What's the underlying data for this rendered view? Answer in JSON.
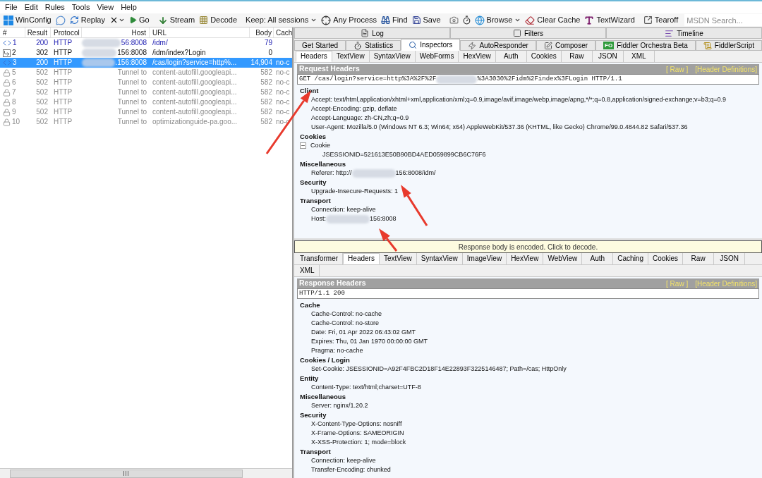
{
  "menu": [
    "File",
    "Edit",
    "Rules",
    "Tools",
    "View",
    "Help"
  ],
  "toolbar": [
    {
      "label": "WinConfig",
      "kind": "button"
    },
    {
      "label": "Replay",
      "kind": "button"
    },
    {
      "label": "Go",
      "kind": "button"
    },
    {
      "label": "Stream",
      "kind": "button"
    },
    {
      "label": "Decode",
      "kind": "button"
    },
    {
      "label": "Keep: All sessions",
      "kind": "dropdown"
    },
    {
      "label": "Any Process",
      "kind": "button"
    },
    {
      "label": "Find",
      "kind": "button"
    },
    {
      "label": "Save",
      "kind": "button"
    },
    {
      "label": "Browse",
      "kind": "dropdown"
    },
    {
      "label": "Clear Cache",
      "kind": "button"
    },
    {
      "label": "TextWizard",
      "kind": "button"
    },
    {
      "label": "Tearoff",
      "kind": "button"
    }
  ],
  "search": {
    "placeholder": "MSDN Search..."
  },
  "sessions": {
    "columns": [
      "#",
      "Result",
      "Protocol",
      "Host",
      "URL",
      "Body",
      "Cach"
    ],
    "rows": [
      {
        "num": "1",
        "result": "200",
        "protocol": "HTTP",
        "host": "56:8008",
        "host_redacted": true,
        "url": "/idm/",
        "body": "79",
        "kind": "html",
        "selected": false
      },
      {
        "num": "2",
        "result": "302",
        "protocol": "HTTP",
        "host": "156:8008",
        "host_redacted": true,
        "url": "/idm/index?Login",
        "body": "0",
        "kind": "redirect",
        "selected": false
      },
      {
        "num": "3",
        "result": "200",
        "protocol": "HTTP",
        "host": ".156:8008",
        "host_redacted": true,
        "url": "/cas/login?service=http%...",
        "body": "14,904",
        "caching": "no-c",
        "kind": "html",
        "selected": true
      },
      {
        "num": "5",
        "result": "502",
        "protocol": "HTTP",
        "host": "Tunnel to",
        "host_redacted": false,
        "url": "content-autofill.googleapi...",
        "body": "582",
        "caching": "no-c",
        "kind": "tunnel",
        "selected": false
      },
      {
        "num": "6",
        "result": "502",
        "protocol": "HTTP",
        "host": "Tunnel to",
        "host_redacted": false,
        "url": "content-autofill.googleapi...",
        "body": "582",
        "caching": "no-c",
        "kind": "tunnel",
        "selected": false
      },
      {
        "num": "7",
        "result": "502",
        "protocol": "HTTP",
        "host": "Tunnel to",
        "host_redacted": false,
        "url": "content-autofill.googleapi...",
        "body": "582",
        "caching": "no-c",
        "kind": "tunnel",
        "selected": false
      },
      {
        "num": "8",
        "result": "502",
        "protocol": "HTTP",
        "host": "Tunnel to",
        "host_redacted": false,
        "url": "content-autofill.googleapi...",
        "body": "582",
        "caching": "no-c",
        "kind": "tunnel",
        "selected": false
      },
      {
        "num": "9",
        "result": "502",
        "protocol": "HTTP",
        "host": "Tunnel to",
        "host_redacted": false,
        "url": "content-autofill.googleapi...",
        "body": "582",
        "caching": "no-c",
        "kind": "tunnel",
        "selected": false
      },
      {
        "num": "10",
        "result": "502",
        "protocol": "HTTP",
        "host": "Tunnel to",
        "host_redacted": false,
        "url": "optimizationguide-pa.goo...",
        "body": "582",
        "caching": "no-c",
        "kind": "tunnel",
        "selected": false
      }
    ]
  },
  "top_tabs": [
    {
      "label": "Log"
    },
    {
      "label": "Filters"
    },
    {
      "label": "Timeline"
    }
  ],
  "main_tabs": [
    {
      "label": "Get Started",
      "selected": false
    },
    {
      "label": "Statistics",
      "selected": false
    },
    {
      "label": "Inspectors",
      "selected": true
    },
    {
      "label": "AutoResponder",
      "selected": false
    },
    {
      "label": "Composer",
      "selected": false
    },
    {
      "label": "Fiddler Orchestra Beta",
      "logo": "FO",
      "selected": false
    },
    {
      "label": "FiddlerScript",
      "selected": false
    }
  ],
  "request": {
    "tabs": [
      [
        {
          "label": "Headers",
          "selected": true
        },
        {
          "label": "TextView",
          "selected": false
        },
        {
          "label": "SyntaxView",
          "selected": false
        },
        {
          "label": "WebForms",
          "selected": false
        },
        {
          "label": "HexView",
          "selected": false
        },
        {
          "label": "Auth",
          "selected": false
        },
        {
          "label": "Cookies",
          "selected": false
        },
        {
          "label": "Raw",
          "selected": false
        },
        {
          "label": "JSON",
          "selected": false
        },
        {
          "label": "XML",
          "selected": false
        }
      ]
    ],
    "title": "Request Headers",
    "links": [
      "[ Raw ]",
      "[Header Definitions]"
    ],
    "first_line": [
      "GET /cas/login?service=http%3A%2F%2F",
      "%3A3030%2Fidm%2Findex%3FLogin HTTP/1.1"
    ],
    "groups": [
      {
        "name": "Client",
        "lines": [
          {
            "kind": "text",
            "text": "Accept: text/html,application/xhtml+xml,application/xml;q=0.9,image/avif,image/webp,image/apng,*/*;q=0.8,application/signed-exchange;v=b3;q=0.9"
          },
          {
            "kind": "text",
            "text": "Accept-Encoding: gzip, deflate"
          },
          {
            "kind": "text",
            "text": "Accept-Language: zh-CN,zh;q=0.9"
          },
          {
            "kind": "text",
            "text": "User-Agent: Mozilla/5.0 (Windows NT 6.3; Win64; x64) AppleWebKit/537.36 (KHTML, like Gecko) Chrome/99.0.4844.82 Safari/537.36"
          }
        ]
      },
      {
        "name": "Cookies",
        "lines": [
          {
            "kind": "tree",
            "text": "Cookie",
            "expanded": true,
            "children": [
              "JSESSIONID=521613E50B90BD4AED059899CB6C76F6"
            ]
          }
        ]
      },
      {
        "name": "Miscellaneous",
        "lines": [
          {
            "kind": "split",
            "parts": [
              "Referer: http://",
              "156:8008/idm/"
            ]
          }
        ]
      },
      {
        "name": "Security",
        "lines": [
          {
            "kind": "text",
            "text": "Upgrade-Insecure-Requests: 1"
          }
        ]
      },
      {
        "name": "Transport",
        "lines": [
          {
            "kind": "text",
            "text": "Connection: keep-alive"
          },
          {
            "kind": "split",
            "parts": [
              "Host:",
              "156:8008"
            ]
          }
        ]
      }
    ]
  },
  "notice": "Response body is encoded. Click to decode.",
  "response": {
    "tabs": [
      [
        {
          "label": "Transformer",
          "selected": false
        },
        {
          "label": "Headers",
          "selected": true
        },
        {
          "label": "TextView",
          "selected": false
        },
        {
          "label": "SyntaxView",
          "selected": false
        },
        {
          "label": "ImageView",
          "selected": false
        },
        {
          "label": "HexView",
          "selected": false
        },
        {
          "label": "WebView",
          "selected": false
        },
        {
          "label": "Auth",
          "selected": false
        },
        {
          "label": "Caching",
          "selected": false
        },
        {
          "label": "Cookies",
          "selected": false
        },
        {
          "label": "Raw",
          "selected": false
        },
        {
          "label": "JSON",
          "selected": false
        }
      ],
      [
        {
          "label": "XML",
          "selected": false
        }
      ]
    ],
    "title": "Response Headers",
    "links": [
      "[ Raw ]",
      "[Header Definitions]"
    ],
    "first_line": [
      "HTTP/1.1 200"
    ],
    "groups": [
      {
        "name": "Cache",
        "lines": [
          {
            "kind": "text",
            "text": "Cache-Control: no-cache"
          },
          {
            "kind": "text",
            "text": "Cache-Control: no-store"
          },
          {
            "kind": "text",
            "text": "Date: Fri, 01 Apr 2022 06:43:02 GMT"
          },
          {
            "kind": "text",
            "text": "Expires: Thu, 01 Jan 1970 00:00:00 GMT"
          },
          {
            "kind": "text",
            "text": "Pragma: no-cache"
          }
        ]
      },
      {
        "name": "Cookies / Login",
        "lines": [
          {
            "kind": "text",
            "text": "Set-Cookie: JSESSIONID=A92F4FBC2D18F14E22893F3225146487; Path=/cas; HttpOnly"
          }
        ]
      },
      {
        "name": "Entity",
        "lines": [
          {
            "kind": "text",
            "text": "Content-Type: text/html;charset=UTF-8"
          }
        ]
      },
      {
        "name": "Miscellaneous",
        "lines": [
          {
            "kind": "text",
            "text": "Server: nginx/1.20.2"
          }
        ]
      },
      {
        "name": "Security",
        "lines": [
          {
            "kind": "text",
            "text": "X-Content-Type-Options: nosniff"
          },
          {
            "kind": "text",
            "text": "X-Frame-Options: SAMEORIGIN"
          },
          {
            "kind": "text",
            "text": "X-XSS-Protection: 1; mode=block"
          }
        ]
      },
      {
        "name": "Transport",
        "lines": [
          {
            "kind": "text",
            "text": "Connection: keep-alive"
          },
          {
            "kind": "text",
            "text": "Transfer-Encoding: chunked"
          }
        ]
      }
    ]
  }
}
